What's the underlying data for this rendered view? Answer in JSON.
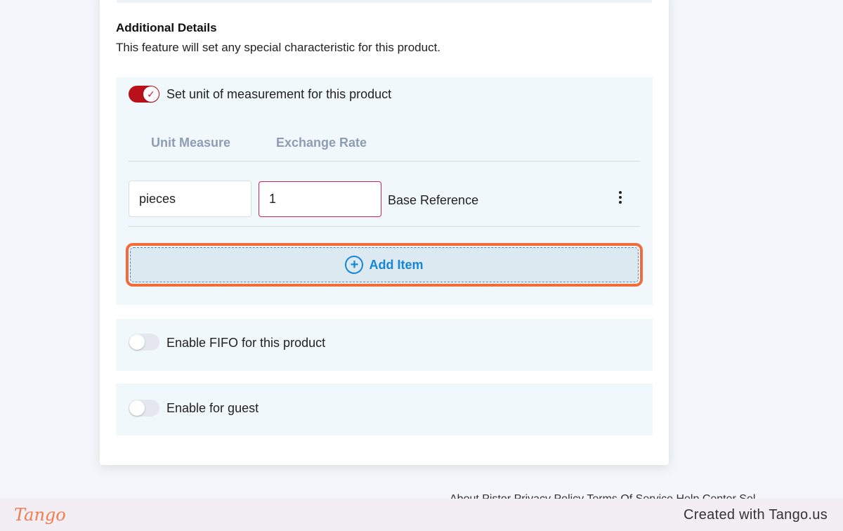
{
  "section": {
    "title": "Additional Details",
    "description": "This feature will set any special characteristic for this product."
  },
  "uom": {
    "toggle_label": "Set unit of measurement for this product",
    "toggle_on": true,
    "columns": [
      "Unit Measure",
      "Exchange Rate"
    ],
    "row": {
      "unit_value": "pieces",
      "rate_value": "1",
      "reference": "Base Reference"
    },
    "add_label": "Add Item"
  },
  "fifo": {
    "toggle_label": "Enable FIFO for this product",
    "toggle_on": false
  },
  "guest": {
    "toggle_label": "Enable for guest",
    "toggle_on": false
  },
  "footer": {
    "links_text": "About Pistor    Privacy Policy    Terms Of Service    Help Center    Sel"
  },
  "tango": {
    "logo": "Tango",
    "credit": "Created with Tango.us"
  },
  "colors": {
    "toggle_on": "#b8111a",
    "highlight": "#f26b3a",
    "link_blue": "#1386d8"
  }
}
